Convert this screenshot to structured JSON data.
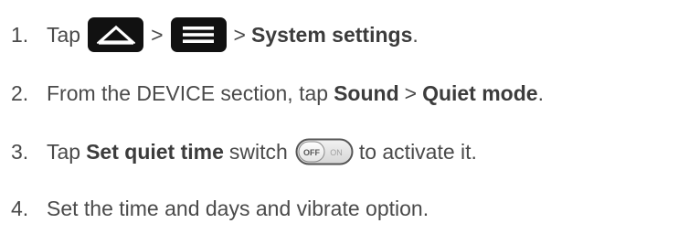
{
  "steps": [
    {
      "number": "1.",
      "parts": {
        "t1": "Tap",
        "t2": ">",
        "t3": ">",
        "b1": "System settings",
        "t4": "."
      },
      "icons": [
        "home-icon",
        "menu-icon"
      ]
    },
    {
      "number": "2.",
      "parts": {
        "t1": "From the DEVICE section, tap",
        "b1": "Sound",
        "t2": ">",
        "b2": "Quiet mode",
        "t3": "."
      }
    },
    {
      "number": "3.",
      "parts": {
        "t1": "Tap",
        "b1": "Set quiet time",
        "t2": "switch",
        "t3": "to activate it."
      },
      "switch": {
        "off_label": "OFF",
        "on_label": "ON"
      }
    },
    {
      "number": "4.",
      "parts": {
        "t1": "Set the time and days and vibrate option."
      }
    }
  ],
  "colors": {
    "text": "#4a4a4a",
    "icon_background": "#111111",
    "icon_foreground": "#ffffff"
  }
}
